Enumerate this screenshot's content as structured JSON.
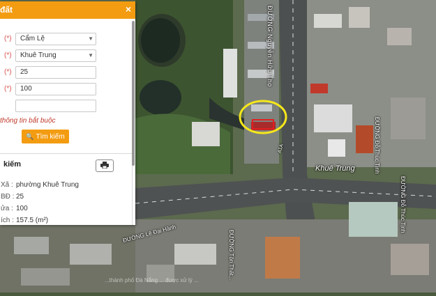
{
  "panel": {
    "title": "đất",
    "close_icon": "×",
    "required_marker": "(*)",
    "district": {
      "value": "Cẩm Lệ"
    },
    "ward": {
      "value": "Khuê Trung"
    },
    "map_sheet": {
      "value": "25"
    },
    "parcel": {
      "value": "100"
    },
    "extra": {
      "value": ""
    },
    "required_note": "thông tin bắt buộc",
    "search_label": "Tìm kiếm",
    "accent_color": "#f39c12"
  },
  "results": {
    "title": "kiếm",
    "rows": [
      {
        "label": "Xã :",
        "value": "phường Khuê Trung"
      },
      {
        "label": "BĐ :",
        "value": "25"
      },
      {
        "label": "ửa :",
        "value": "100"
      },
      {
        "label": "ích :",
        "value": "157.5 (m²)"
      }
    ]
  },
  "map": {
    "road_labels": [
      "ĐƯỜNG Nguyễn Hữu Thọ",
      "ĐƯỜNG Đỗ Thúc Tịnh",
      "ĐƯỜNG Đỗ Thúc Tịnh",
      "ĐƯỜNG Tôn Thất...",
      "ĐƯỜNG Lê Đại Hành"
    ],
    "ward_label": "Khuê Trung",
    "route_label": "A1A",
    "copyright": "...thành phố Đà Nẵng ... được xử lý ..."
  }
}
